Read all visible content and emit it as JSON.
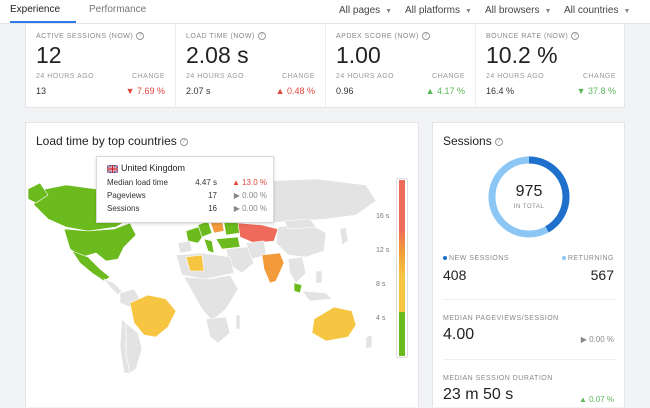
{
  "tabs": [
    {
      "label": "Experience",
      "active": true
    },
    {
      "label": "Performance",
      "active": false
    }
  ],
  "filters": [
    "All pages",
    "All platforms",
    "All browsers",
    "All countries"
  ],
  "stats": [
    {
      "label": "ACTIVE SESSIONS (NOW)",
      "value": "12",
      "sub": "24 HOURS AGO",
      "change_label": "CHANGE",
      "prev": "13",
      "change": "▼ 7.69 %",
      "trend": "red"
    },
    {
      "label": "LOAD TIME (NOW)",
      "value": "2.08 s",
      "sub": "24 HOURS AGO",
      "change_label": "CHANGE",
      "prev": "2.07 s",
      "change": "▲ 0.48 %",
      "trend": "red"
    },
    {
      "label": "APDEX SCORE (NOW)",
      "value": "1.00",
      "sub": "24 HOURS AGO",
      "change_label": "CHANGE",
      "prev": "0.96",
      "change": "▲ 4.17 %",
      "trend": "green"
    },
    {
      "label": "BOUNCE RATE (NOW)",
      "value": "10.2 %",
      "sub": "24 HOURS AGO",
      "change_label": "CHANGE",
      "prev": "16.4 %",
      "change": "▼ 37.8 %",
      "trend": "green"
    }
  ],
  "map_panel": {
    "title": "Load time by top countries",
    "tooltip": {
      "country": "United Kingdom",
      "rows": [
        {
          "label": "Median load time",
          "value": "4.47 s",
          "change": "▲ 13.0 %",
          "trend": "red"
        },
        {
          "label": "Pageviews",
          "value": "17",
          "change": "▶ 0.00 %",
          "trend": "gray"
        },
        {
          "label": "Sessions",
          "value": "16",
          "change": "▶ 0.00 %",
          "trend": "gray"
        }
      ]
    },
    "legend_ticks": [
      "16 s",
      "12 s",
      "8 s",
      "4 s"
    ],
    "colors": {
      "fast": "#6cbb1e",
      "medium": "#f6c642",
      "slow": "#f39a3b",
      "slowest": "#ef6a5a",
      "nodata": "#e3e3e3"
    }
  },
  "sessions_panel": {
    "title": "Sessions",
    "total": "975",
    "total_label": "IN TOTAL",
    "new_label": "NEW SESSIONS",
    "new_value": "408",
    "returning_label": "RETURNING",
    "returning_value": "567",
    "pageviews_label": "MEDIAN PAGEVIEWS/SESSION",
    "pageviews_value": "4.00",
    "pageviews_change": "▶ 0.00 %",
    "duration_label": "MEDIAN SESSION DURATION",
    "duration_value": "23 m 50 s",
    "duration_change": "▲ 0.07 %",
    "new_fraction": 0.418,
    "colors": {
      "new": "#1f6fcc",
      "returning": "#8cc6f5"
    }
  }
}
